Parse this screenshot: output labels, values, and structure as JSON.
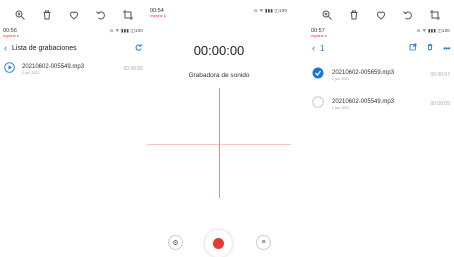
{
  "toolbars": {
    "left": [
      "zoom-in-icon",
      "trash-icon",
      "heart-icon",
      "rotate-icon",
      "crop-icon"
    ],
    "right": [
      "zoom-in-icon",
      "trash-icon",
      "heart-icon",
      "rotate-icon",
      "crop-icon"
    ]
  },
  "screen1": {
    "status": {
      "time": "00:56",
      "rec": "registrar ●",
      "icons": "⊙ ᯤ ▮▮▮ ◫100"
    },
    "title": "Lista de grabaciones",
    "items": [
      {
        "name": "20210602-005549.mp3",
        "date": "2 jun. 2021",
        "duration": "00:00:05"
      }
    ]
  },
  "screen2": {
    "status": {
      "time": "00:54",
      "rec": "registrar ●",
      "icons": "⊙ ᯤ ▮▮▮ ◫100"
    },
    "timer": "00:00:00",
    "label": "Grabadora de sonido"
  },
  "screen3": {
    "status": {
      "time": "00:57",
      "rec": "registrar ●",
      "icons": "⊙ ᯤ ▮▮▮ ◫100"
    },
    "selected_count": "1",
    "items": [
      {
        "name": "20210602-005659.mp3",
        "date": "2 jun. 2021",
        "duration": "00:00:07",
        "checked": true
      },
      {
        "name": "20210602-005549.mp3",
        "date": "2 jun. 2021",
        "duration": "00:00:05",
        "checked": false
      }
    ]
  },
  "colors": {
    "accent": "#1976d2",
    "record": "#e53935",
    "waveline": "#f28b82"
  }
}
